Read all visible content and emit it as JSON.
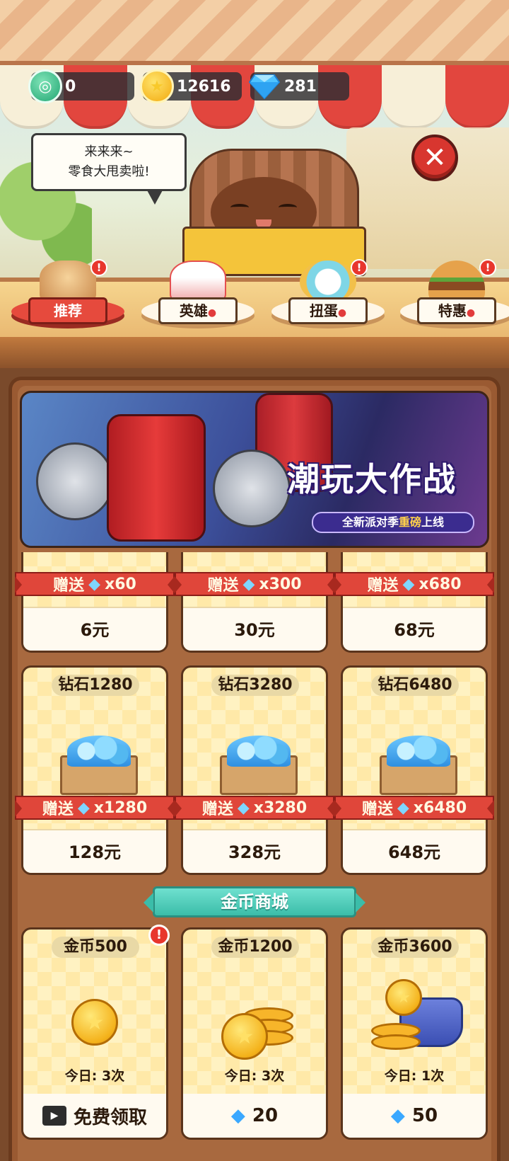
{
  "currencies": {
    "tickets": "0",
    "gold": "12616",
    "gems": "281"
  },
  "npc": {
    "line1": "来来来~",
    "line2": "零食大甩卖啦!"
  },
  "icons": {
    "close": "close-icon",
    "ticket": "ticket-icon",
    "gold": "gold-coin-icon",
    "gem": "diamond-icon",
    "video": "video-ad-icon",
    "alert": "alert-icon",
    "strawberry": "strawberry-icon"
  },
  "tabs": [
    {
      "label": "推荐",
      "active": true,
      "badge": "!"
    },
    {
      "label": "英雄",
      "active": false
    },
    {
      "label": "扭蛋",
      "active": false,
      "badge": "!"
    },
    {
      "label": "特惠",
      "active": false,
      "badge": "!"
    }
  ],
  "banner": {
    "title": "潮玩大作战",
    "subtitle_pre": "全新派对季",
    "subtitle_hl": "重磅",
    "subtitle_post": "上线"
  },
  "gift_label": "赠送",
  "gem_products_row1": [
    {
      "bonus": "x60",
      "price": "6元"
    },
    {
      "bonus": "x300",
      "price": "30元"
    },
    {
      "bonus": "x680",
      "price": "68元"
    }
  ],
  "gem_products_row2": [
    {
      "title": "钻石1280",
      "bonus": "x1280",
      "price": "128元"
    },
    {
      "title": "钻石3280",
      "bonus": "x3280",
      "price": "328元"
    },
    {
      "title": "钻石6480",
      "bonus": "x6480",
      "price": "648元"
    }
  ],
  "coin_shop": {
    "title": "金币商城",
    "items": [
      {
        "title": "金币500",
        "today": "今日: 3次",
        "action": "免费领取"
      },
      {
        "title": "金币1200",
        "today": "今日: 3次",
        "action": "20"
      },
      {
        "title": "金币3600",
        "today": "今日: 1次",
        "action": "50"
      }
    ]
  },
  "colors": {
    "accent_red": "#e0463a",
    "teal": "#3bbda9",
    "gold": "#f4b21b",
    "gem_blue": "#3aa8ff",
    "wood": "#9a5a32"
  }
}
